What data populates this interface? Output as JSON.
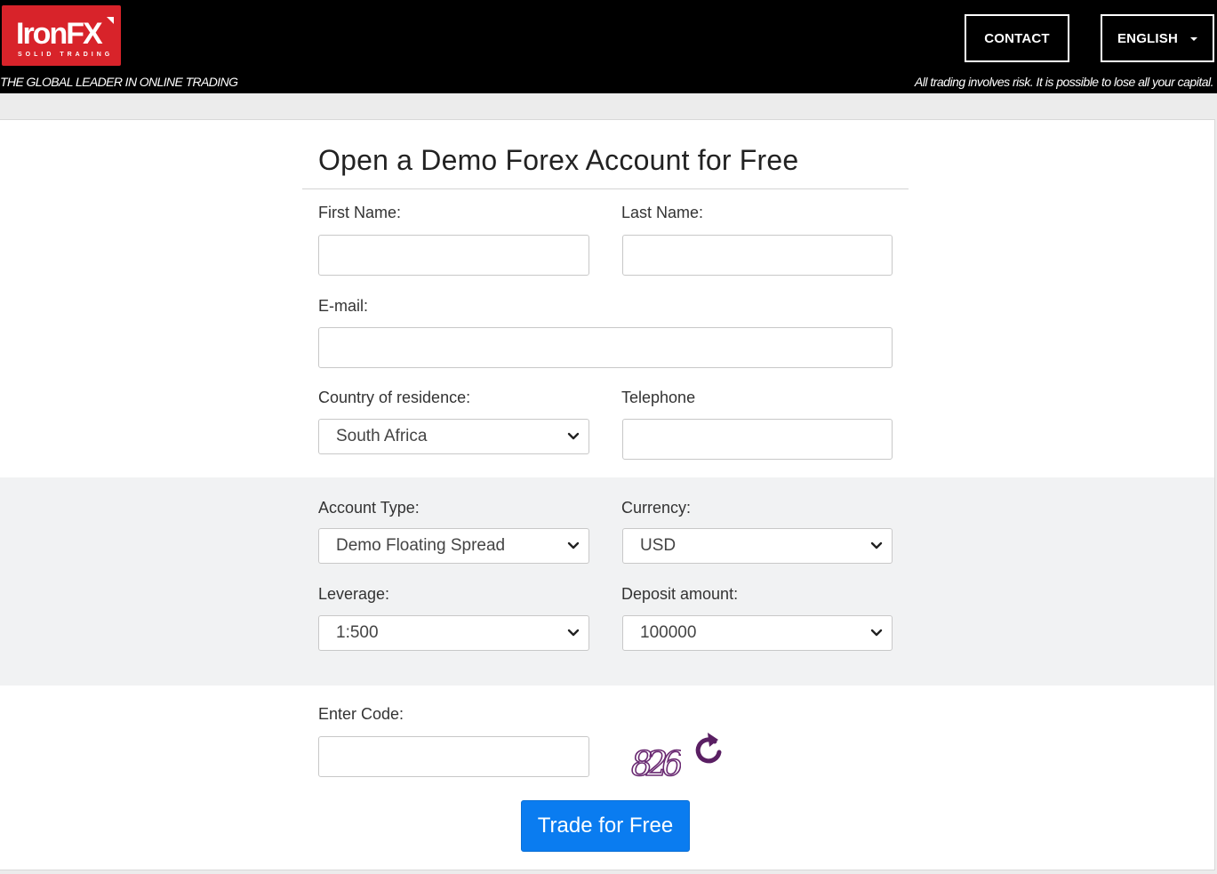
{
  "header": {
    "logo_text": "IronFX",
    "logo_subtext": "SOLID TRADING",
    "tagline": "THE GLOBAL LEADER IN ONLINE TRADING",
    "risk_warning": "All trading involves risk. It is possible to lose all your capital.",
    "contact_label": "CONTACT",
    "language_label": "ENGLISH"
  },
  "form": {
    "title": "Open a Demo Forex Account for Free",
    "first_name_label": "First Name:",
    "last_name_label": "Last Name:",
    "email_label": "E-mail:",
    "country_label": "Country of residence:",
    "country_value": "South Africa",
    "telephone_label": "Telephone",
    "account_type_label": "Account Type:",
    "account_type_value": "Demo Floating Spread",
    "currency_label": "Currency:",
    "currency_value": "USD",
    "leverage_label": "Leverage:",
    "leverage_value": "1:500",
    "deposit_label": "Deposit amount:",
    "deposit_value": "100000",
    "code_label": "Enter Code:",
    "captcha_text": "826",
    "submit_label": "Trade for Free"
  },
  "colors": {
    "header_bg": "#000000",
    "logo_red": "#d8232a",
    "cta_blue": "#0a7cf0",
    "captcha_purple": "#6a2a72"
  },
  "icons": {
    "select_chevron": "chevron-down-icon",
    "refresh": "refresh-icon",
    "language_caret": "caret-down-icon"
  }
}
